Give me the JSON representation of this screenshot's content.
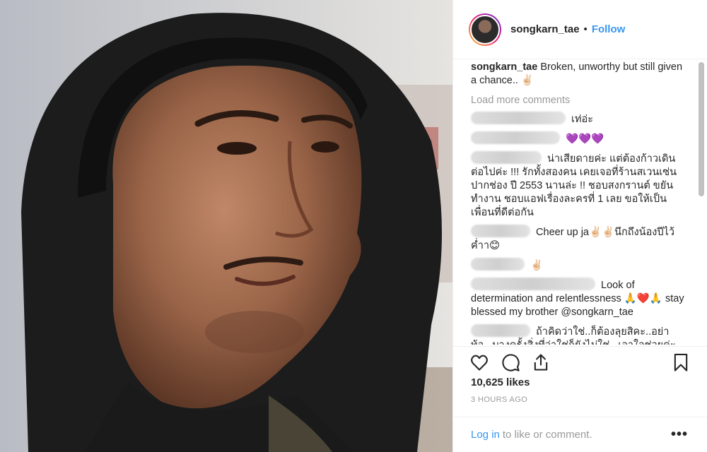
{
  "header": {
    "username": "songkarn_tae",
    "separator": "•",
    "follow_label": "Follow"
  },
  "caption": {
    "username": "songkarn_tae",
    "text": "Broken, unworthy but still given a chance.. ✌🏻"
  },
  "load_more_label": "Load more comments",
  "comments": [
    {
      "text": "เท่อ่ะ"
    },
    {
      "text": "💜💜💜"
    },
    {
      "text": "น่าเสียดายค่ะ แต่ต้องก้าวเดินต่อไปค่ะ !!! รักทั้งสองคน เคยเจอที่ร้านสเวนเซ่นปากช่อง ปี 2553 นานล่ะ !! ชอบสงกรานต์ ขยันทำงาน ชอบแอฟเรื่องละครที่ 1 เลย ขอให้เป็นเพื่อนที่ดีต่อกัน"
    },
    {
      "text": "Cheer up ja✌🏻✌🏻นึกถึงน้องปีไว้ค่ำา😊"
    },
    {
      "text": "✌🏻"
    },
    {
      "text": "Look of determination and relentlessness 🙏❤️🙏 stay blessed my brother @songkarn_tae"
    },
    {
      "text": "ถ้าคิดว่าใช่..ก็ต้องลุยสิคะ..อย่าท้อ...บางครั้งสิ่งที่ว่าใช่ก็ยังไม่ใช่...เอาใจช่วยค่ะ"
    }
  ],
  "icons": {
    "like": "heart-icon",
    "comment": "comment-icon",
    "share": "share-icon",
    "save": "bookmark-icon",
    "more": "more-options-icon"
  },
  "likes_label": "10,625 likes",
  "timestamp": "3 HOURS AGO",
  "footer": {
    "login_label": "Log in",
    "rest_label": "to like or comment.",
    "more_label": "•••"
  },
  "colors": {
    "accent": "#3897f0",
    "muted": "#999999",
    "text": "#262626",
    "heart_purple": "#b36ee6"
  }
}
